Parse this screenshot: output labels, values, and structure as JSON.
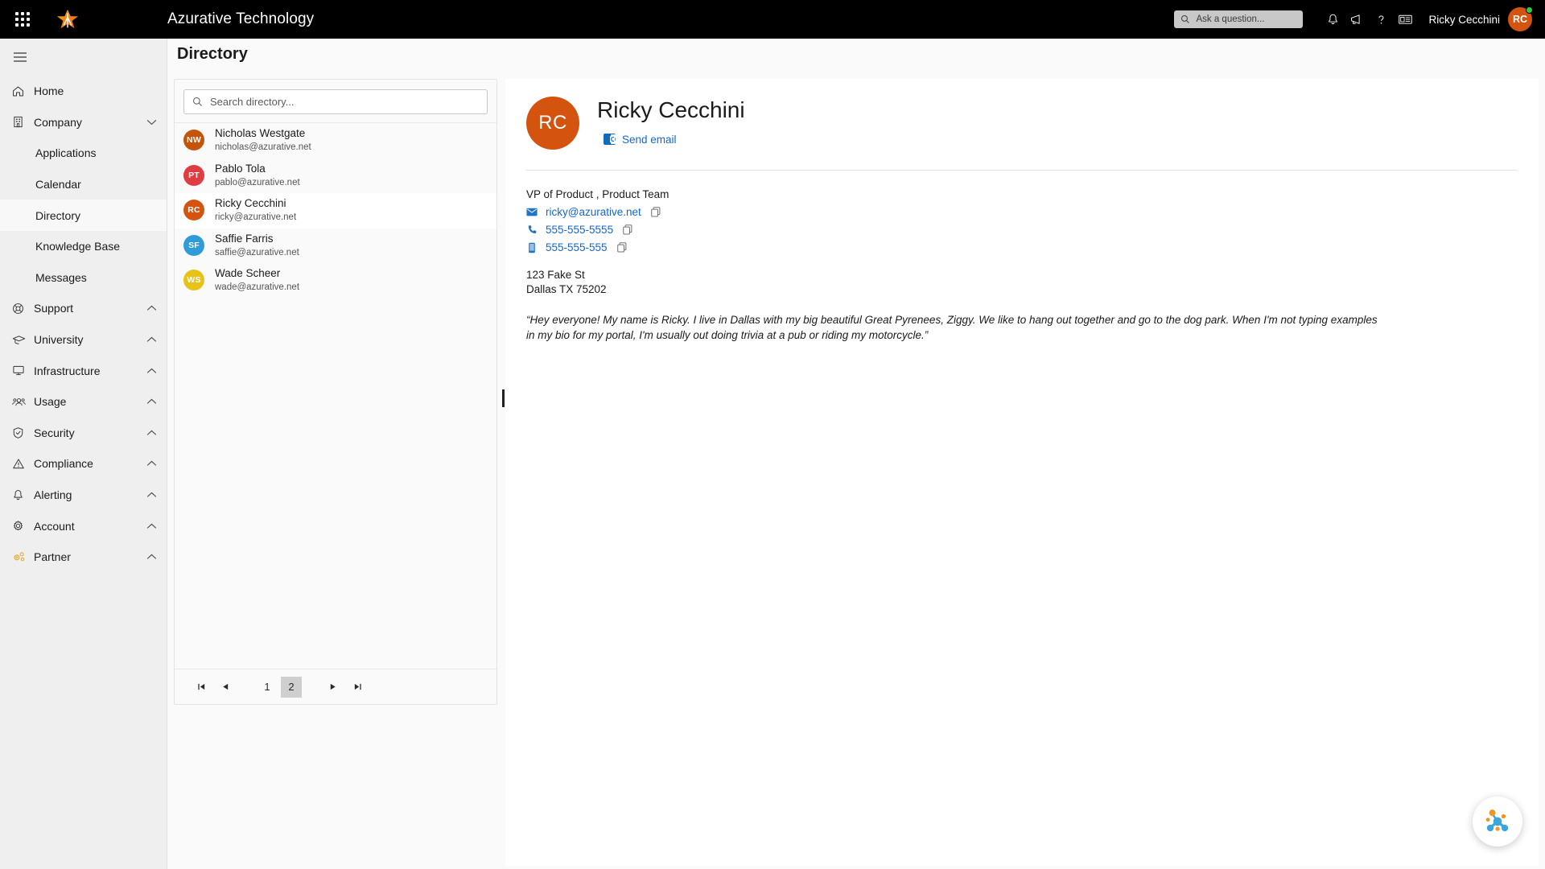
{
  "topbar": {
    "app_title": "Azurative Technology",
    "waffle_name": "app-launcher",
    "quick_search_placeholder": "Ask a question...",
    "icons": [
      "bell-icon",
      "megaphone-icon",
      "help-icon",
      "news-icon"
    ],
    "user_name": "Ricky Cecchini",
    "user_initials": "RC",
    "avatar_color": "#d4540f",
    "status_color": "#2ecc40"
  },
  "sidebar": {
    "items": [
      {
        "label": "Home",
        "icon": "home-icon",
        "type": "item",
        "chevron": ""
      },
      {
        "label": "Company",
        "icon": "building-icon",
        "type": "item",
        "chevron": "down"
      },
      {
        "label": "Applications",
        "icon": "",
        "type": "sub",
        "active": false
      },
      {
        "label": "Calendar",
        "icon": "",
        "type": "sub",
        "active": false
      },
      {
        "label": "Directory",
        "icon": "",
        "type": "sub",
        "active": true
      },
      {
        "label": "Knowledge Base",
        "icon": "",
        "type": "sub",
        "active": false
      },
      {
        "label": "Messages",
        "icon": "",
        "type": "sub",
        "active": false
      },
      {
        "label": "Support",
        "icon": "lifebuoy-icon",
        "type": "item",
        "chevron": "up"
      },
      {
        "label": "University",
        "icon": "graduation-cap-icon",
        "type": "item",
        "chevron": "up"
      },
      {
        "label": "Infrastructure",
        "icon": "monitor-icon",
        "type": "item",
        "chevron": "up"
      },
      {
        "label": "Usage",
        "icon": "people-icon",
        "type": "item",
        "chevron": "up"
      },
      {
        "label": "Security",
        "icon": "shield-check-icon",
        "type": "item",
        "chevron": "up"
      },
      {
        "label": "Compliance",
        "icon": "warning-triangle-icon",
        "type": "item",
        "chevron": "up"
      },
      {
        "label": "Alerting",
        "icon": "bell-icon",
        "type": "item",
        "chevron": "up"
      },
      {
        "label": "Account",
        "icon": "gear-icon",
        "type": "item",
        "chevron": "up"
      },
      {
        "label": "Partner",
        "icon": "gears-icon",
        "type": "item",
        "chevron": "up"
      }
    ]
  },
  "page": {
    "title": "Directory"
  },
  "list": {
    "search_placeholder": "Search directory...",
    "people": [
      {
        "initials": "NW",
        "name": "Nicholas Westgate",
        "email": "nicholas@azurative.net",
        "color": "#c5540b",
        "selected": false
      },
      {
        "initials": "PT",
        "name": "Pablo Tola",
        "email": "pablo@azurative.net",
        "color": "#e03c42",
        "selected": false
      },
      {
        "initials": "RC",
        "name": "Ricky Cecchini",
        "email": "ricky@azurative.net",
        "color": "#d4540f",
        "selected": true
      },
      {
        "initials": "SF",
        "name": "Saffie Farris",
        "email": "saffie@azurative.net",
        "color": "#2f9bd8",
        "selected": false
      },
      {
        "initials": "WS",
        "name": "Wade Scheer",
        "email": "wade@azurative.net",
        "color": "#e8c219",
        "selected": false
      }
    ],
    "pagination": {
      "first_label": "⏮",
      "prev_label": "◀",
      "next_label": "▶",
      "last_label": "⏭",
      "pages": [
        "1",
        "2"
      ],
      "current_page": "2"
    }
  },
  "detail": {
    "initials": "RC",
    "avatar_color": "#d4540f",
    "name": "Ricky Cecchini",
    "send_email_label": "Send email",
    "role": "VP of Product , Product Team",
    "email": "ricky@azurative.net",
    "phone": "555-555-5555",
    "mobile": "555-555-555",
    "address_line1": "123 Fake St",
    "address_line2": "Dallas TX 75202",
    "bio": "“Hey everyone! My name is Ricky. I live in Dallas with my big beautiful Great Pyrenees, Ziggy. We like to hang out together and go to the dog park. When I'm not typing examples in my bio for my portal, I'm usually out doing trivia at a pub or riding my motorcycle.”"
  },
  "fab": {
    "name": "network-assistant-icon",
    "orange": "#f2941f",
    "blue": "#3aa6dd"
  }
}
